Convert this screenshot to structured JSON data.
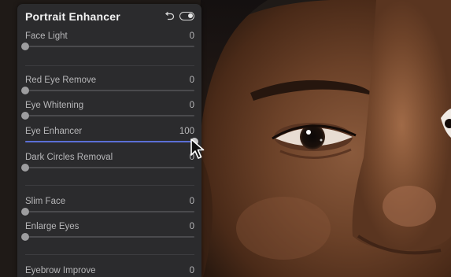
{
  "panel": {
    "title": "Portrait Enhancer",
    "reset_icon": "undo-icon",
    "toggle_icon": "toggle-icon",
    "toggle_state": "on"
  },
  "sliders": [
    {
      "label": "Face Light",
      "value": "0",
      "fraction": 0
    },
    {
      "label": "Red Eye Remove",
      "value": "0",
      "fraction": 0
    },
    {
      "label": "Eye Whitening",
      "value": "0",
      "fraction": 0
    },
    {
      "label": "Eye Enhancer",
      "value": "100",
      "fraction": 1,
      "active": true
    },
    {
      "label": "Dark Circles Removal",
      "value": "0",
      "fraction": 0
    },
    {
      "label": "Slim Face",
      "value": "0",
      "fraction": 0
    },
    {
      "label": "Enlarge Eyes",
      "value": "0",
      "fraction": 0
    },
    {
      "label": "Eyebrow Improve",
      "value": "0",
      "fraction": 0
    }
  ],
  "colors": {
    "panel_bg": "#2b2b2d",
    "accent": "#5b6fd6",
    "text": "#b6b6b8",
    "title": "#f2f2f2"
  },
  "cursor_icon": "pointer-arrow-icon"
}
